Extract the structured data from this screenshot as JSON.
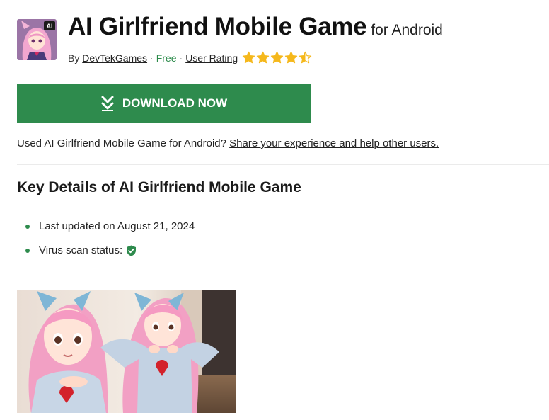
{
  "app": {
    "name": "AI Girlfriend Mobile Game",
    "platform": "for Android",
    "icon_badge": "AI"
  },
  "meta": {
    "by_prefix": "By",
    "developer": "DevTekGames",
    "separator": "·",
    "price": "Free",
    "rating_label": "User Rating",
    "rating": 4.5,
    "rating_max": 5,
    "star_color": "#f5b81c"
  },
  "download": {
    "label": "DOWNLOAD NOW",
    "color": "#2e8b4d"
  },
  "feedback": {
    "prompt": "Used AI Girlfriend Mobile Game for Android?",
    "link": "Share your experience and help other users."
  },
  "key_details": {
    "heading": "Key Details of AI Girlfriend Mobile Game",
    "items": [
      {
        "text": "Last updated on August 21, 2024"
      },
      {
        "text": "Virus scan status:",
        "icon": "shield-check-icon"
      }
    ]
  }
}
